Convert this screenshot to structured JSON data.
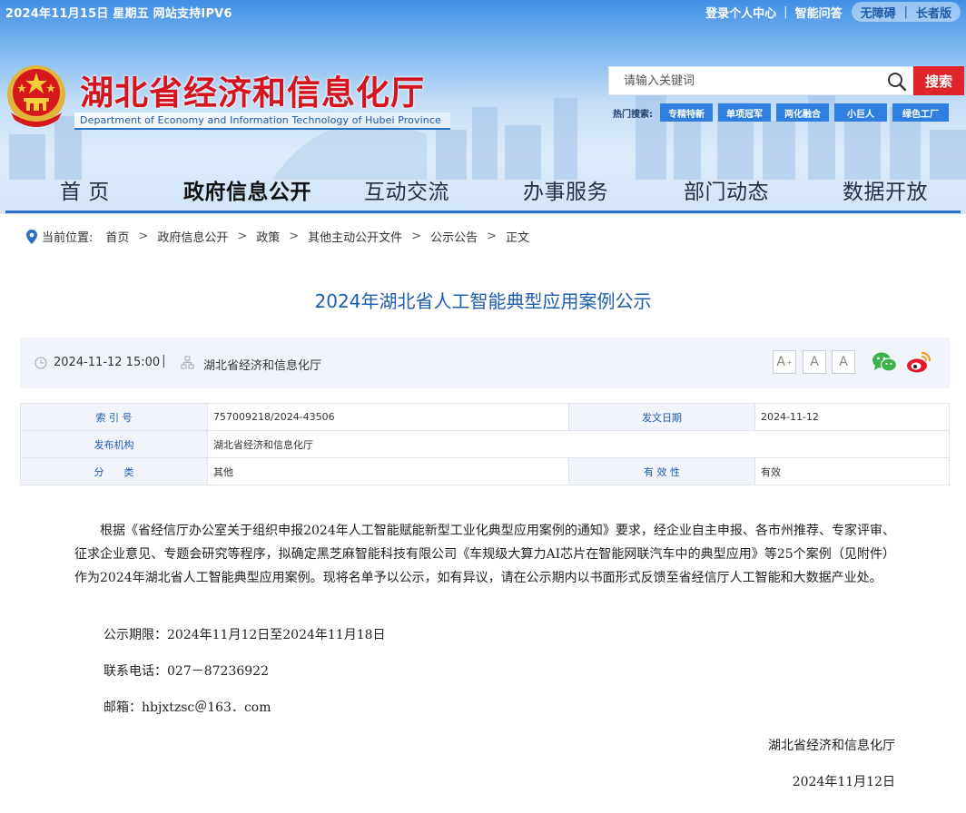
{
  "topbar": {
    "date": "2024年11月15日 星期五  网站支持IPV6",
    "login": "登录个人中心",
    "sep": "|",
    "qa": "智能问答",
    "barrier_free": "无障碍",
    "bar": "|",
    "elder": "长者版"
  },
  "brand": {
    "title": "湖北省经济和信息化厅",
    "subtitle": "Department of Economy and Information Technology of Hubei Province"
  },
  "search": {
    "placeholder": "请输入关键词",
    "button": "搜索",
    "hot_label": "热门搜索:",
    "hot_tags": [
      "专精特新",
      "单项冠军",
      "两化融合",
      "小巨人",
      "绿色工厂"
    ]
  },
  "nav": {
    "items": [
      "首 页",
      "政府信息公开",
      "互动交流",
      "办事服务",
      "部门动态",
      "数据开放"
    ]
  },
  "breadcrumb": {
    "label": "当前位置:",
    "items": [
      "首页",
      "政府信息公开",
      "政策",
      "其他主动公开文件",
      "公示公告",
      "正文"
    ],
    "sep": ">"
  },
  "article": {
    "title": "2024年湖北省人工智能典型应用案例公示",
    "date": "2024-11-12 15:00",
    "sep": "|",
    "org": "湖北省经济和信息化厅",
    "font_buttons": [
      "A",
      "A",
      "A"
    ],
    "font_plus": "+",
    "meta": {
      "index_label": "索 引 号",
      "index_value": "757009218/2024-43506",
      "date_label": "发文日期",
      "date_value": "2024-11-12",
      "issuer_label": "发布机构",
      "issuer_value": "湖北省经济和信息化厅",
      "category_label": "分　　类",
      "category_value": "其他",
      "validity_label": "有 效 性",
      "validity_value": "有效"
    },
    "body": "根据《省经信厅办公室关于组织申报2024年人工智能赋能新型工业化典型应用案例的通知》要求，经企业自主申报、各市州推荐、专家评审、征求企业意见、专题会研究等程序，拟确定黑芝麻智能科技有限公司《车规级大算力AI芯片在智能网联汽车中的典型应用》等25个案例（见附件）作为2024年湖北省人工智能典型应用案例。现将名单予以公示，如有异议，请在公示期内以书面形式反馈至省经信厅人工智能和大数据产业处。",
    "period": "公示期限：2024年11月12日至2024年11月18日",
    "phone": "联系电话：027－87236922",
    "email": "邮箱：hbjxtzsc＠163．com",
    "signature": "湖北省经济和信息化厅",
    "sign_date": "2024年11月12日"
  },
  "colors": {
    "brand_red": "#d4141e",
    "nav_blue": "#2a70c8",
    "title_blue": "#1e5cb0",
    "search_red": "#e0252a",
    "tag_blue": "#2f7fe0"
  }
}
